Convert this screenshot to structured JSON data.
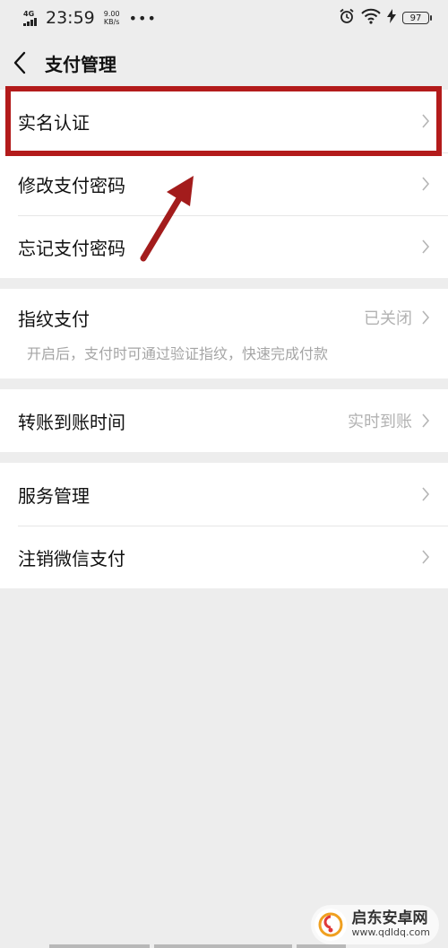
{
  "status_bar": {
    "network": "4G",
    "time": "23:59",
    "speed_value": "9.00",
    "speed_unit": "KB/s",
    "more": "•••",
    "battery": "97"
  },
  "header": {
    "title": "支付管理"
  },
  "groups": [
    {
      "items": [
        {
          "label": "实名认证"
        },
        {
          "label": "修改支付密码"
        },
        {
          "label": "忘记支付密码"
        }
      ]
    },
    {
      "items": [
        {
          "label": "指纹支付",
          "value": "已关闭",
          "description": "开启后，支付时可通过验证指纹，快速完成付款"
        }
      ]
    },
    {
      "items": [
        {
          "label": "转账到账时间",
          "value": "实时到账"
        }
      ]
    },
    {
      "items": [
        {
          "label": "服务管理"
        },
        {
          "label": "注销微信支付"
        }
      ]
    }
  ],
  "colors": {
    "highlight": "#b31b1b",
    "page_background": "#ededed"
  },
  "watermark": {
    "title": "启东安卓网",
    "url": "www.qdldq.com"
  }
}
